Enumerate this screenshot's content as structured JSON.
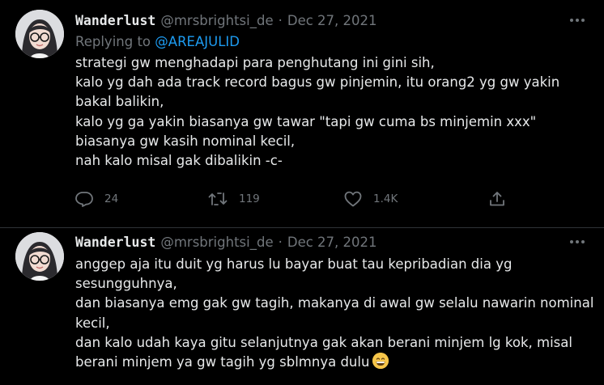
{
  "tweets": [
    {
      "display_name": "Wanderlust",
      "handle": "@mrsbrightsi_de",
      "separator": "·",
      "date": "Dec 27, 2021",
      "replying_prefix": "Replying to",
      "replying_to": "@AREAJULID",
      "lines": [
        "strategi gw menghadapi para penghutang ini gini sih,",
        "kalo yg dah ada track record bagus gw pinjemin, itu orang2 yg gw yakin",
        "bakal balikin,",
        "kalo yg ga yakin biasanya gw tawar \"tapi gw cuma bs minjemin xxx\"",
        "biasanya gw kasih nominal kecil,",
        "nah kalo misal gak dibalikin -c-"
      ],
      "actions": {
        "reply_count": "24",
        "retweet_count": "119",
        "like_count": "1.4K"
      }
    },
    {
      "display_name": "Wanderlust",
      "handle": "@mrsbrightsi_de",
      "separator": "·",
      "date": "Dec 27, 2021",
      "lines": [
        "anggep aja itu duit yg harus lu bayar buat tau kepribadian dia yg",
        "sesungguhnya,",
        "dan biasanya emg gak gw tagih, makanya di awal gw selalu nawarin nominal",
        "kecil,",
        "dan kalo udah kaya gitu selanjutnya gak akan berani minjem lg kok, misal",
        "berani minjem ya gw tagih yg sblmnya dulu"
      ],
      "emoji": "grinning-face-emoji"
    }
  ],
  "colors": {
    "background": "#000000",
    "text": "#e7e9ea",
    "muted": "#71767b",
    "link": "#1d9bf0",
    "divider": "#2f3336"
  },
  "icons": [
    "more-icon",
    "reply-icon",
    "retweet-icon",
    "like-icon",
    "share-icon"
  ]
}
